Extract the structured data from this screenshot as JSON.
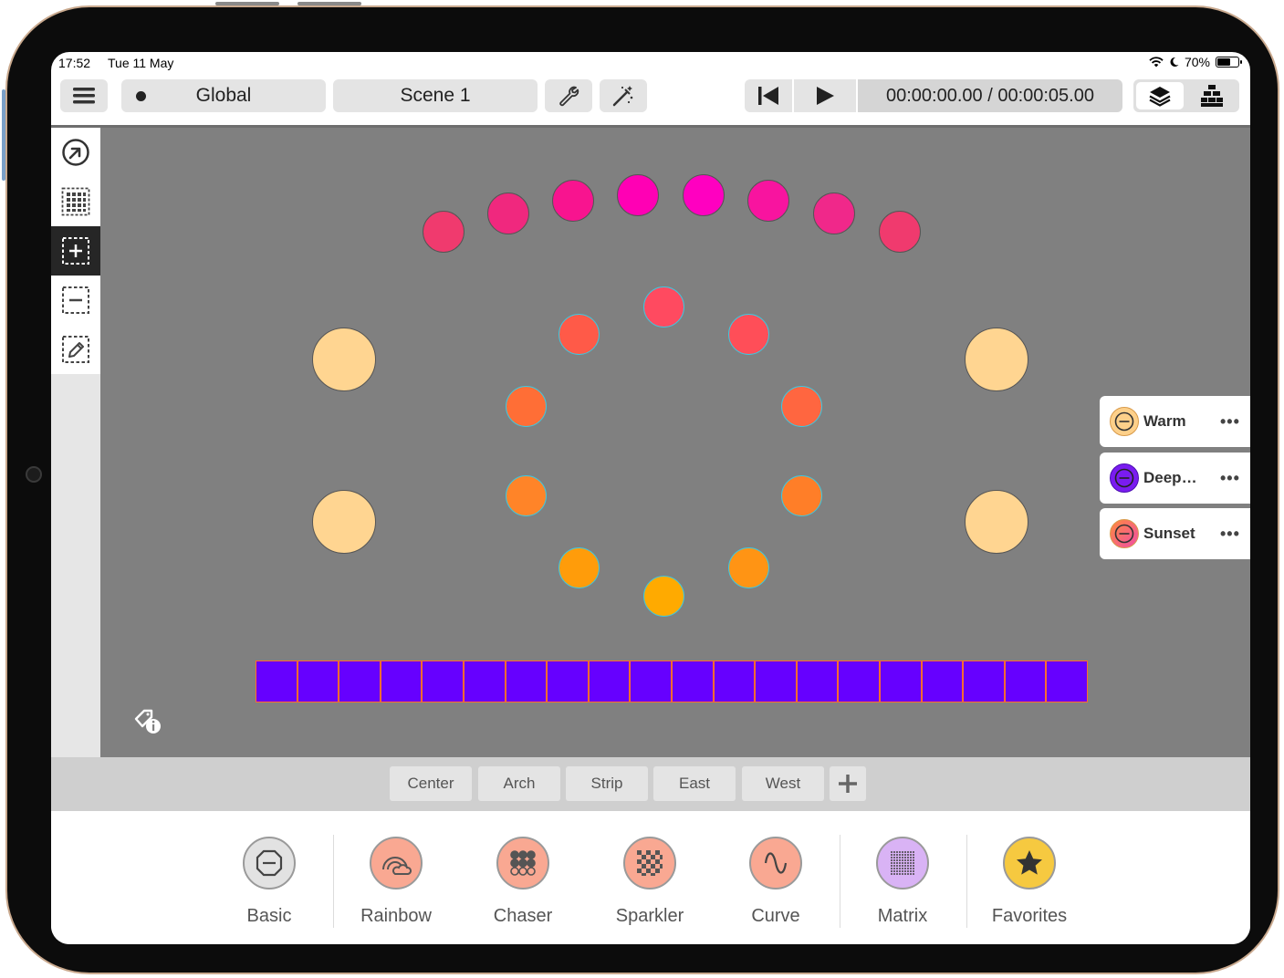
{
  "status": {
    "time": "17:52",
    "date": "Tue 11 May",
    "battery": "70%",
    "battery_level": 0.7
  },
  "toolbar": {
    "scope_label": "Global",
    "scene_label": "Scene 1",
    "time_current": "00:00:00.00",
    "time_separator": " / ",
    "time_total": "00:00:05.00"
  },
  "left_tools": [
    "direction-icon",
    "grid-select-icon",
    "add-select-icon",
    "remove-select-icon",
    "edit-select-icon"
  ],
  "palettes": [
    {
      "name": "Warm",
      "color": "#fdd08a"
    },
    {
      "name": "Deep…",
      "color": "#7a1cf0"
    },
    {
      "name": "Sunset",
      "color": "#f05ca0"
    }
  ],
  "groups": [
    "Center",
    "Arch",
    "Strip",
    "East",
    "West"
  ],
  "effects": [
    {
      "label": "Basic",
      "color": "#e2e2e2"
    },
    {
      "label": "Rainbow",
      "color": "#f9a892"
    },
    {
      "label": "Chaser",
      "color": "#f9a892"
    },
    {
      "label": "Sparkler",
      "color": "#f9a892"
    },
    {
      "label": "Curve",
      "color": "#f9a892"
    },
    {
      "label": "Matrix",
      "color": "#d9b3f5"
    },
    {
      "label": "Favorites",
      "color": "#f6c940"
    }
  ],
  "fixture_colors": {
    "arch": "#ff00c0",
    "ring": "#ff5050",
    "side": "#ffd591",
    "strip": "#6600ff"
  }
}
